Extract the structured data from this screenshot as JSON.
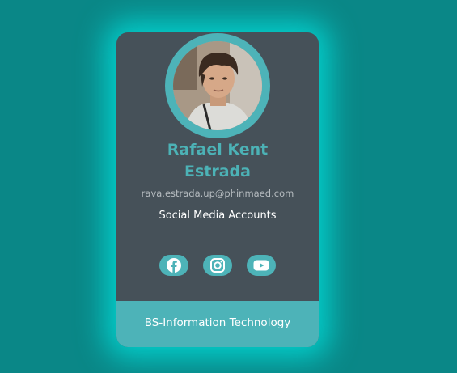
{
  "profile": {
    "name_line1": "Rafael Kent",
    "name_line2": "Estrada",
    "email": "rava.estrada.up@phinmaed.com",
    "social_title": "Social Media Accounts",
    "avatar_alt": "Rafael Kent Estrada"
  },
  "social": [
    {
      "icon": "facebook-icon"
    },
    {
      "icon": "instagram-icon"
    },
    {
      "icon": "youtube-icon"
    }
  ],
  "footer": {
    "text": "BS-Information Technology"
  },
  "colors": {
    "background": "#0a8787",
    "card": "#465159",
    "accent": "#4db3b8",
    "glow": "#00e6e1"
  }
}
